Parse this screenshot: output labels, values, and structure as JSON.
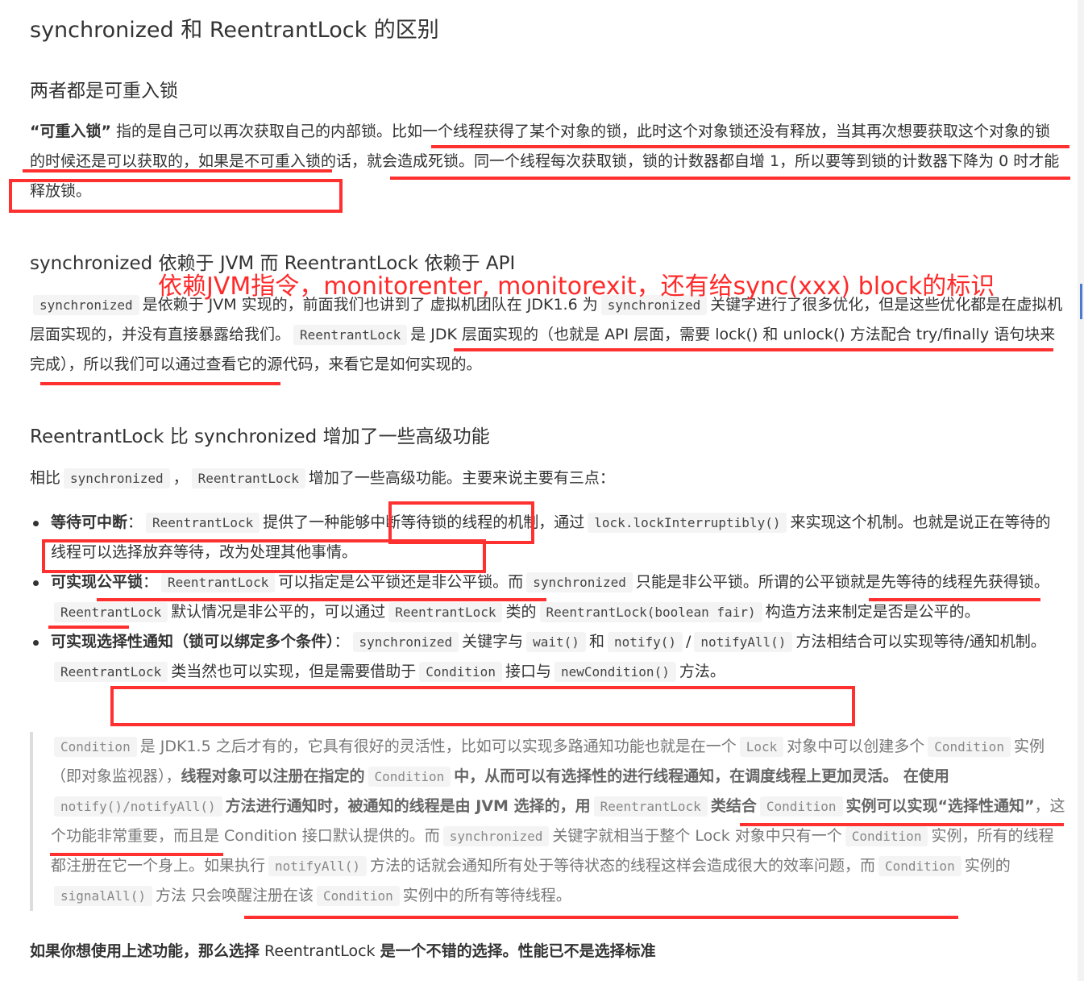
{
  "title": "synchronized 和 ReentrantLock 的区别",
  "sec1": {
    "heading": "两者都是可重入锁",
    "p1": "“可重入锁”",
    "p2": " 指的是自己可以再次获取自己的内部锁。比如一个线程获得了某个对象的锁，此时这个对象锁还没有释放，当其再次想要获取这个对象的锁的时候还是可以获取的，如果是不可重入锁的话，就会造成死锁。同一个线程每次获取锁，锁的计数器都自增 1，所以要等到锁的计数器下降为 0 时才能释放锁。"
  },
  "sec2": {
    "heading": "synchronized 依赖于 JVM 而 ReentrantLock 依赖于 API",
    "annotation": "依赖JVM指令，monitorenter, monitorexit，还有给sync(xxx) block的标识",
    "code1": "synchronized",
    "t1": "是依赖于 JVM 实现的，前面我们也讲到了 虚拟机团队在 JDK1.6 为",
    "code2": "synchronized",
    "t2": "关键字进行了很多优化，但是这些优化都是在虚拟机层面实现的，并没有直接暴露给我们。",
    "code3": "ReentrantLock",
    "t3": "是 JDK 层面实现的（也就是 API 层面，需要 lock() 和 unlock() 方法配合 try/finally 语句块来完成），所以我们可以通过查看它的源代码，来看它是如何实现的。"
  },
  "sec3": {
    "heading": "ReentrantLock 比 synchronized 增加了一些高级功能",
    "i1": "相比",
    "c1": "synchronized",
    "i2": "，",
    "c2": "ReentrantLock",
    "i3": "增加了一些高级功能。主要来说主要有三点：",
    "b1": {
      "label": "等待可中断",
      "sep": "：",
      "c1": "ReentrantLock",
      "t1": "提供了一种能够中断等待锁的线程的机制，通过",
      "c2": "lock.lockInterruptibly()",
      "t2": "来实现这个机制。也就是说正在等待的线程可以选择放弃等待，改为处理其他事情。"
    },
    "b2": {
      "label": "可实现公平锁",
      "sep": "：",
      "c1": "ReentrantLock",
      "t1": "可以指定是公平锁还是非公平锁。而",
      "c2": "synchronized",
      "t2": "只能是非公平锁。所谓的公平锁就是先等待的线程先获得锁。",
      "c3": "ReentrantLock",
      "t3": "默认情况是非公平的，可以通过",
      "c4": "ReentrantLock",
      "t4": "类的",
      "c5": "ReentrantLock(boolean fair)",
      "t5": "构造方法来制定是否是公平的。"
    },
    "b3": {
      "label": "可实现选择性通知（锁可以绑定多个条件）",
      "sep": "：",
      "c1": "synchronized",
      "t1": "关键字与",
      "c2": "wait()",
      "t2": "和",
      "c3": "notify()",
      "t3": "/",
      "c4": "notifyAll()",
      "t4": "方法相结合可以实现等待/通知机制。",
      "c5": "ReentrantLock",
      "t5": "类当然也可以实现，但是需要借助于",
      "c6": "Condition",
      "t6": "接口与",
      "c7": "newCondition()",
      "t7": "方法。"
    }
  },
  "quote": {
    "c1": "Condition",
    "t1": "是 JDK1.5 之后才有的，它具有很好的灵活性，比如可以实现多路通知功能也就是在一个",
    "c2": "Lock",
    "t2": "对象中可以创建多个",
    "c3": "Condition",
    "t3": "实例（即对象监视器），",
    "s1": "线程对象可以注册在指定的",
    "c4": "Condition",
    "s2": "中，从而可以有选择性的进行线程通知，在调度线程上更加灵活。 在使用",
    "c5": "notify()/notifyAll()",
    "s3": "方法进行通知时，被通知的线程是由 JVM 选择的，用",
    "c6": "ReentrantLock",
    "s4": "类结合",
    "c7": "Condition",
    "s5": "实例可以实现“选择性通知”",
    "t4": "，这个功能非常重要，而且是 Condition 接口默认提供的。而",
    "c8": "synchronized",
    "t5": "关键字就相当于整个 Lock 对象中只有一个",
    "c9": "Condition",
    "t6": "实例，所有的线程都注册在它一个身上。如果执行",
    "c10": "notifyAll()",
    "t7": "方法的话就会通知所有处于等待状态的线程这样会造成很大的效率问题，而",
    "c11": "Condition",
    "t8": "实例的",
    "c12": "signalAll()",
    "t9": "方法 只会唤醒注册在该",
    "c13": "Condition",
    "t10": "实例中的所有等待线程。"
  },
  "final": {
    "s1": "如果你想使用上述功能，那么选择",
    "t1": " ReentrantLock ",
    "s2": "是一个不错的选择。性能已不是选择标准"
  },
  "colors": {
    "annotation": "#ff3030",
    "text": "#333333",
    "quote": "#777777"
  }
}
